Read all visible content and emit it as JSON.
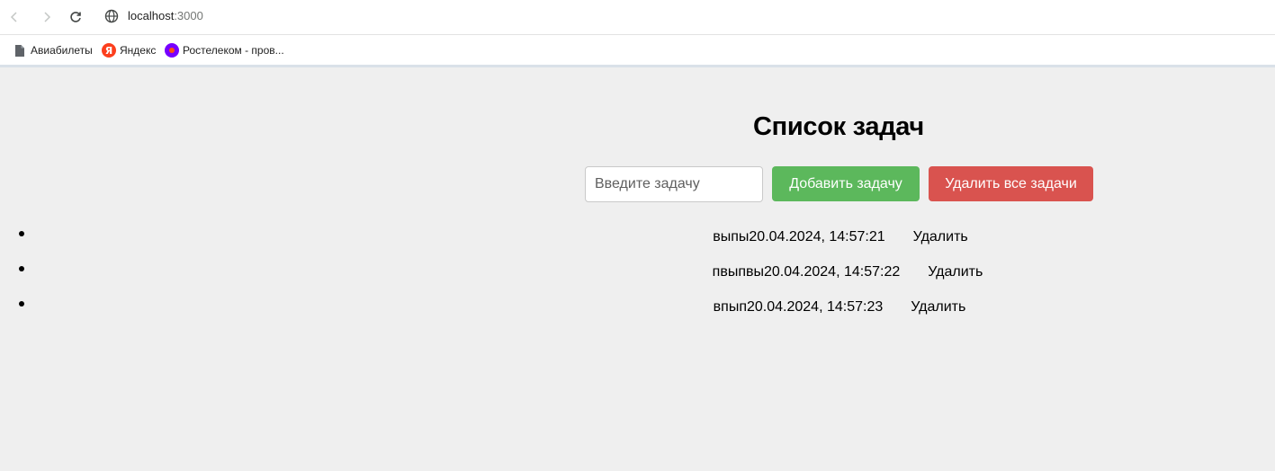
{
  "browser": {
    "url_host": "localhost",
    "url_port": ":3000",
    "bookmarks": [
      {
        "label": "Авиабилеты",
        "icon": "page-icon"
      },
      {
        "label": "Яндекс",
        "icon": "yandex-icon",
        "glyph": "Я"
      },
      {
        "label": "Ростелеком - пров...",
        "icon": "rostelecom-icon"
      }
    ]
  },
  "app": {
    "title": "Список задач",
    "input_placeholder": "Введите задачу",
    "input_value": "",
    "add_label": "Добавить задачу",
    "clear_label": "Удалить все задачи",
    "delete_label": "Удалить",
    "colors": {
      "add": "#5cb85c",
      "clear": "#d9534f",
      "background": "#efefef"
    },
    "tasks": [
      {
        "name": "выпы",
        "date": "20.04.2024, 14:57:21"
      },
      {
        "name": "пвыпвы",
        "date": "20.04.2024, 14:57:22"
      },
      {
        "name": "впып",
        "date": "20.04.2024, 14:57:23"
      }
    ]
  }
}
